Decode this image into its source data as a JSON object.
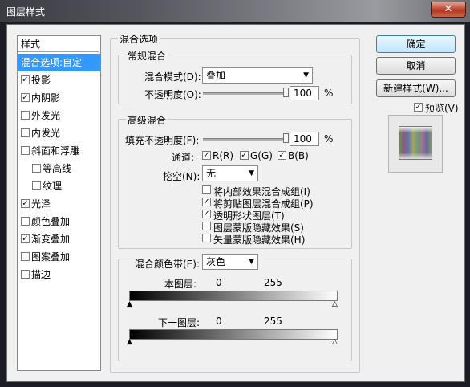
{
  "window": {
    "title": "图层样式",
    "close_glyph": "✕"
  },
  "styles_list": {
    "header": "样式",
    "items": [
      {
        "label": "混合选项:自定",
        "checkbox": false,
        "checked": false,
        "selected": true
      },
      {
        "label": "投影",
        "checkbox": true,
        "checked": true
      },
      {
        "label": "内阴影",
        "checkbox": true,
        "checked": true
      },
      {
        "label": "外发光",
        "checkbox": true,
        "checked": false
      },
      {
        "label": "内发光",
        "checkbox": true,
        "checked": false
      },
      {
        "label": "斜面和浮雕",
        "checkbox": true,
        "checked": false
      },
      {
        "label": "等高线",
        "checkbox": true,
        "checked": false,
        "indent": true
      },
      {
        "label": "纹理",
        "checkbox": true,
        "checked": false,
        "indent": true
      },
      {
        "label": "光泽",
        "checkbox": true,
        "checked": true
      },
      {
        "label": "颜色叠加",
        "checkbox": true,
        "checked": false
      },
      {
        "label": "渐变叠加",
        "checkbox": true,
        "checked": true
      },
      {
        "label": "图案叠加",
        "checkbox": true,
        "checked": false
      },
      {
        "label": "描边",
        "checkbox": true,
        "checked": false
      }
    ]
  },
  "blend_options": {
    "title": "混合选项",
    "general": {
      "title": "常规混合",
      "mode_label": "混合模式(D):",
      "mode_value": "叠加",
      "opacity_label": "不透明度(O):",
      "opacity_value": "100",
      "opacity_unit": "%",
      "opacity_level": 1.0
    },
    "advanced": {
      "title": "高级混合",
      "fill_label": "填充不透明度(F):",
      "fill_value": "100",
      "fill_unit": "%",
      "fill_level": 1.0,
      "channels_label": "通道:",
      "channels": [
        {
          "label": "R(R)",
          "checked": true
        },
        {
          "label": "G(G)",
          "checked": true
        },
        {
          "label": "B(B)",
          "checked": true
        }
      ],
      "knockout_label": "挖空(N):",
      "knockout_value": "无",
      "options": [
        {
          "label": "将内部效果混合成组(I)",
          "checked": false
        },
        {
          "label": "将剪贴图层混合成组(P)",
          "checked": true
        },
        {
          "label": "透明形状图层(T)",
          "checked": true
        },
        {
          "label": "图层蒙版隐藏效果(S)",
          "checked": false
        },
        {
          "label": "矢量蒙版隐藏效果(H)",
          "checked": false
        }
      ]
    },
    "blend_if": {
      "label": "混合颜色带(E):",
      "value": "灰色",
      "this_layer_label": "本图层:",
      "this_layer_min": "0",
      "this_layer_max": "255",
      "underlying_label": "下一图层:",
      "underlying_min": "0",
      "underlying_max": "255"
    }
  },
  "buttons": {
    "ok": "确定",
    "cancel": "取消",
    "new_style": "新建样式(W)...",
    "preview_label": "预览(V)",
    "preview_checked": true
  },
  "colors": {
    "selection": "#3399ff",
    "primary_button_border": "#3c7fb1"
  }
}
